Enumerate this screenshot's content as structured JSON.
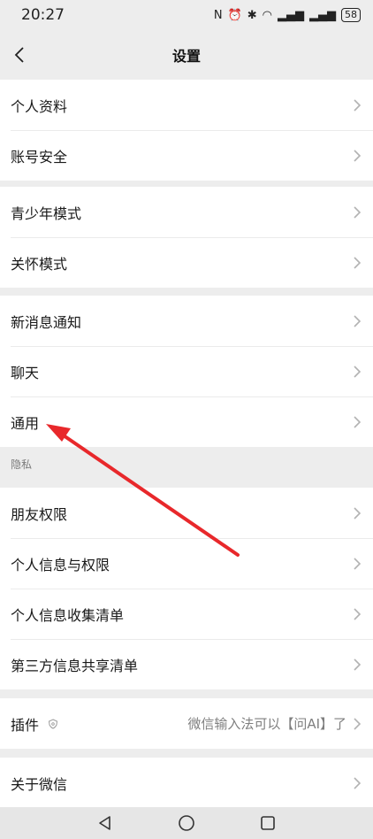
{
  "status": {
    "time": "20:27",
    "battery": "58"
  },
  "header": {
    "title": "设置"
  },
  "groups": [
    {
      "items": [
        {
          "label": "个人资料"
        },
        {
          "label": "账号安全"
        }
      ]
    },
    {
      "items": [
        {
          "label": "青少年模式"
        },
        {
          "label": "关怀模式"
        }
      ]
    },
    {
      "items": [
        {
          "label": "新消息通知"
        },
        {
          "label": "聊天"
        },
        {
          "label": "通用"
        }
      ]
    },
    {
      "section": "隐私",
      "items": [
        {
          "label": "朋友权限"
        },
        {
          "label": "个人信息与权限"
        },
        {
          "label": "个人信息收集清单"
        },
        {
          "label": "第三方信息共享清单"
        }
      ]
    },
    {
      "items": [
        {
          "label": "插件",
          "value": "微信输入法可以【问AI】了"
        }
      ]
    },
    {
      "items": [
        {
          "label": "关于微信"
        }
      ]
    }
  ],
  "icons": {
    "back": "chevron-left-icon",
    "row_arrow": "chevron-right-icon",
    "plugin_badge": "shield-icon",
    "nav_back": "triangle-back-icon",
    "nav_home": "circle-home-icon",
    "nav_recent": "square-recent-icon"
  },
  "colors": {
    "background": "#ededed",
    "row": "#ffffff",
    "annotation_arrow": "#e8282b"
  }
}
